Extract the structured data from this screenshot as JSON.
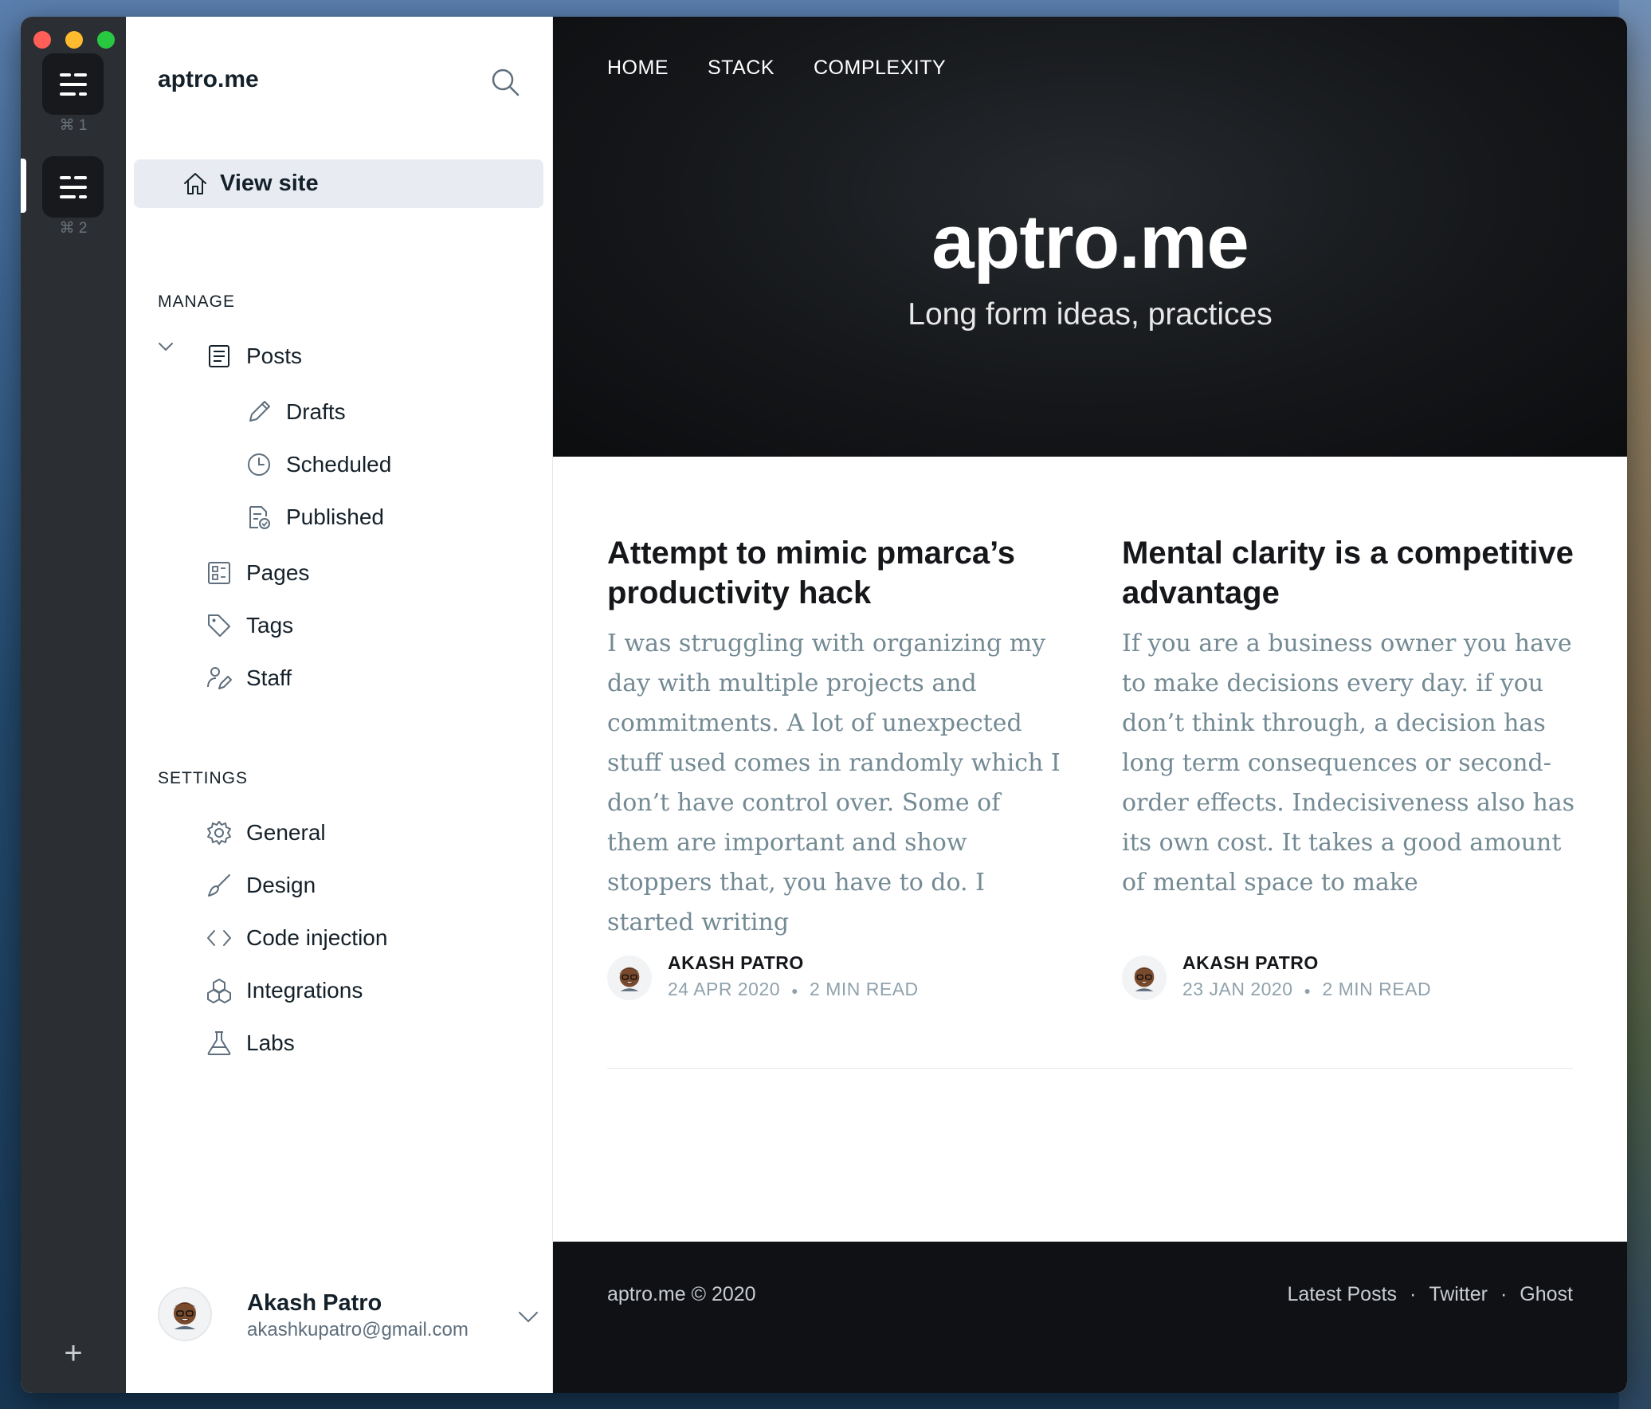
{
  "rail": {
    "sites": [
      {
        "shortcut": "⌘ 1"
      },
      {
        "shortcut": "⌘ 2"
      }
    ],
    "add_label": "+"
  },
  "sidebar": {
    "brand": "aptro.me",
    "view_site": "View site",
    "manage_heading": "MANAGE",
    "posts": "Posts",
    "drafts": "Drafts",
    "scheduled": "Scheduled",
    "published": "Published",
    "pages": "Pages",
    "tags": "Tags",
    "staff": "Staff",
    "settings_heading": "SETTINGS",
    "general": "General",
    "design": "Design",
    "code_injection": "Code injection",
    "integrations": "Integrations",
    "labs": "Labs",
    "user": {
      "name": "Akash Patro",
      "email": "akashkupatro@gmail.com"
    }
  },
  "site": {
    "nav": [
      "HOME",
      "STACK",
      "COMPLEXITY"
    ],
    "title": "aptro.me",
    "subtitle": "Long form ideas, practices",
    "posts": [
      {
        "title": "Attempt to mimic pmarca’s productivity hack",
        "excerpt": "I was struggling with organizing my day with multiple projects and commitments. A lot of unexpected stuff used comes in randomly which I don’t have control over. Some of them are important and show stoppers that, you have to do. I started writing",
        "author": "AKASH PATRO",
        "date": "24 APR 2020",
        "read": "2 MIN READ"
      },
      {
        "title": "Mental clarity is a competitive advantage",
        "excerpt": "If you are a business owner you have to make decisions every day. if you don’t think through, a decision has long term consequences or second-order effects. Indecisiveness also has its own cost. It takes a good amount of mental space to make",
        "author": "AKASH PATRO",
        "date": "23 JAN 2020",
        "read": "2 MIN READ"
      }
    ],
    "footer": {
      "copy": "aptro.me © 2020",
      "links": [
        "Latest Posts",
        "Twitter",
        "Ghost"
      ],
      "separator": "·"
    }
  },
  "colors": {
    "rail_bg": "#2b2f33",
    "sidebar_active_bg": "#e8ecf2",
    "hero_bg": "#15171a",
    "excerpt_text": "#738a94",
    "meta_text": "#90a2ad"
  }
}
